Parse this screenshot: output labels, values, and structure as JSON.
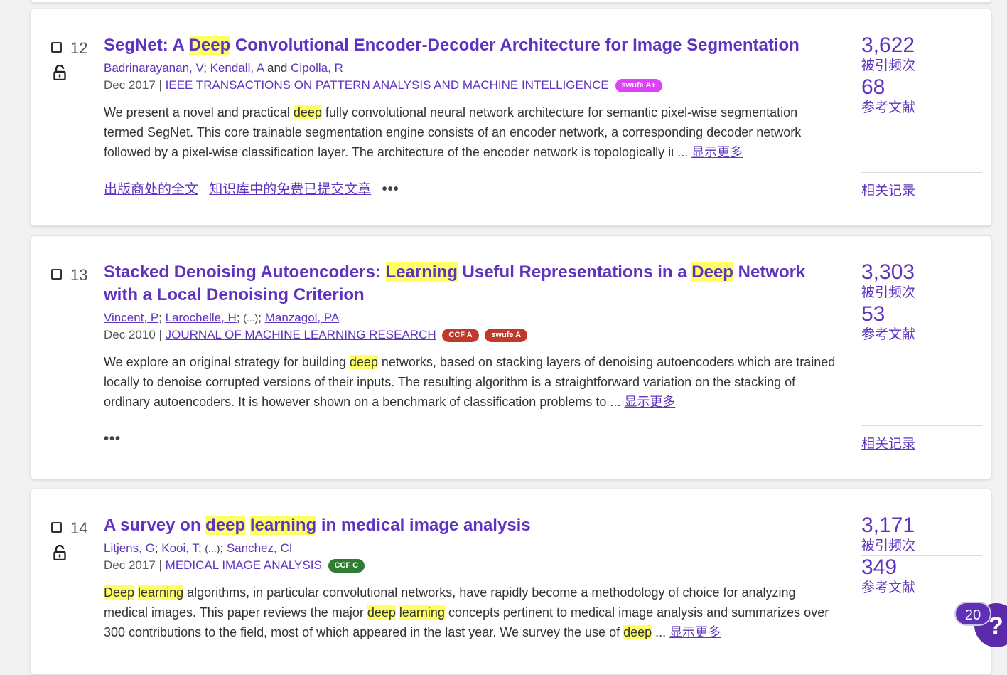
{
  "colors": {
    "accent": "#5e33bf",
    "highlight": "#ffff66",
    "swufe_aplus": "#e040fb",
    "ccf_a": "#c0392b",
    "swufe_a": "#c0392b",
    "ccf_c": "#2e7d32"
  },
  "records": [
    {
      "number": "12",
      "title_parts": [
        "SegNet: A ",
        "Deep",
        " Convolutional Encoder-Decoder Architecture for Image Segmentation"
      ],
      "authors": [
        "Badrinarayanan, V",
        "Kendall, A",
        "Cipolla, R"
      ],
      "author_and": "and",
      "date": "Dec 2017",
      "journal": "IEEE TRANSACTIONS ON PATTERN ANALYSIS AND MACHINE INTELLIGENCE",
      "badges": [
        "swufe A+"
      ],
      "abstract_parts": [
        "We present a novel and practical ",
        "deep",
        " fully convolutional neural network architecture for semantic pixel-wise segmentation termed SegNet. This core trainable segmentation engine consists of an encoder network, a corresponding decoder network followed by a pixel-wise classification layer. The architecture of the encoder network is topologically iι ..."
      ],
      "show_more": "显示更多",
      "links": [
        "出版商处的全文",
        "知识库中的免费已提交文章"
      ],
      "citations": "3,622",
      "citations_label": "被引频次",
      "references": "68",
      "references_label": "参考文献",
      "related": "相关记录"
    },
    {
      "number": "13",
      "title_parts": [
        "Stacked Denoising Autoencoders: ",
        "Learning",
        " Useful Representations in a ",
        "Deep",
        " Network with a Local Denoising Criterion"
      ],
      "authors": [
        "Vincent, P",
        "Larochelle, H",
        "Manzagol, PA"
      ],
      "author_ellipsis": "(...)",
      "date": "Dec 2010",
      "journal": "JOURNAL OF MACHINE LEARNING RESEARCH",
      "badges": [
        "CCF A",
        "swufe A"
      ],
      "abstract_parts": [
        "We explore an original strategy for building ",
        "deep",
        " networks, based on stacking layers of denoising autoencoders which are trained locally to denoise corrupted versions of their inputs. The resulting algorithm is a straightforward variation on the stacking of ordinary autoencoders. It is however shown on a benchmark of classification problems to ..."
      ],
      "show_more": "显示更多",
      "citations": "3,303",
      "citations_label": "被引频次",
      "references": "53",
      "references_label": "参考文献",
      "related": "相关记录"
    },
    {
      "number": "14",
      "title_parts": [
        "A survey on ",
        "deep",
        " ",
        "learning",
        " in medical image analysis"
      ],
      "authors": [
        "Litjens, G",
        "Kooi, T",
        "Sanchez, CI"
      ],
      "author_ellipsis": "(...)",
      "date": "Dec 2017",
      "journal": "MEDICAL IMAGE ANALYSIS",
      "badges": [
        "CCF C"
      ],
      "abstract_parts": [
        "Deep",
        " ",
        "learning",
        " algorithms, in particular convolutional networks, have rapidly become a methodology of choice for analyzing medical images. This paper reviews the major ",
        "deep",
        " ",
        "learning",
        " concepts pertinent to medical image analysis and summarizes over 300 contributions to the field, most of which appeared in the last year. We survey the use of ",
        "deep",
        " ..."
      ],
      "show_more": "显示更多",
      "citations": "3,171",
      "citations_label": "被引频次",
      "references": "349",
      "references_label": "参考文献"
    }
  ],
  "more_icon": "•••",
  "help": {
    "count": "20",
    "icon": "?"
  }
}
